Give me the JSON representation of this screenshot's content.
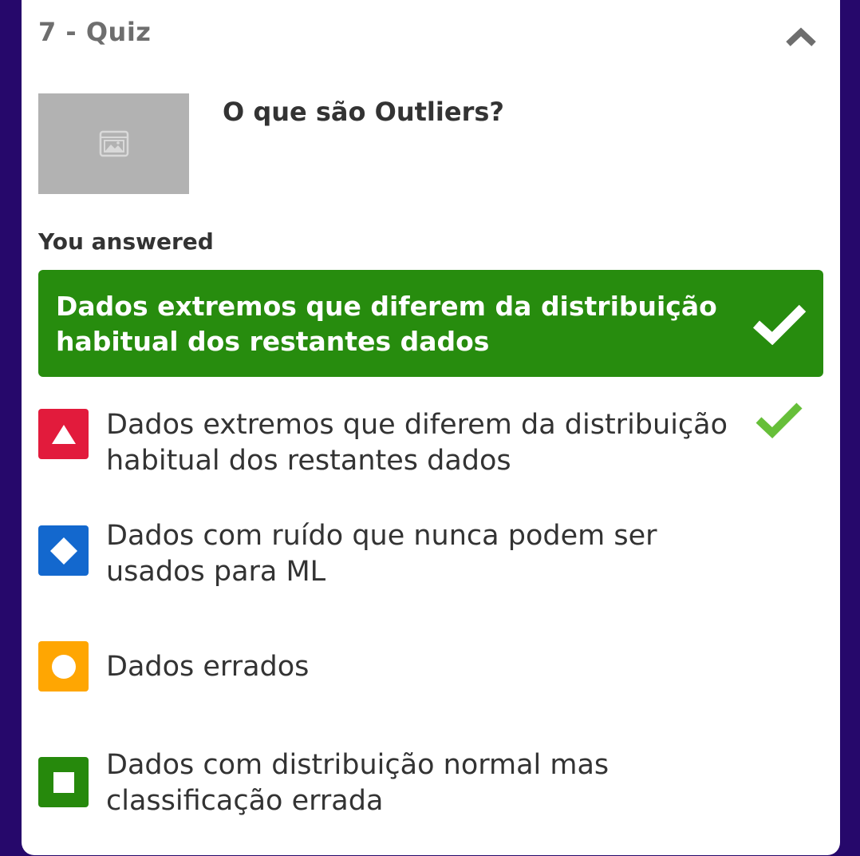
{
  "quiz": {
    "header_title": "7 - Quiz",
    "question": "O que são Outliers?",
    "answered_label": "You answered",
    "answered_text": "Dados extremos que diferem da distribuição habitual dos restantes dados",
    "options": [
      {
        "text": "Dados extremos que diferem da distribuição habitual dos restantes dados",
        "shape": "triangle-icon",
        "color": "#e21b3c",
        "correct": true
      },
      {
        "text": "Dados com ruído que nunca podem ser usados para ML",
        "shape": "diamond-icon",
        "color": "#1368ce",
        "correct": false
      },
      {
        "text": "Dados errados",
        "shape": "circle-icon",
        "color": "#ffa602",
        "correct": false
      },
      {
        "text": "Dados com distribuição normal mas classificação errada",
        "shape": "square-icon",
        "color": "#26890c",
        "correct": false
      }
    ]
  },
  "colors": {
    "background": "#26086b",
    "correct_green": "#278c0e",
    "check_green": "#66bf39"
  }
}
